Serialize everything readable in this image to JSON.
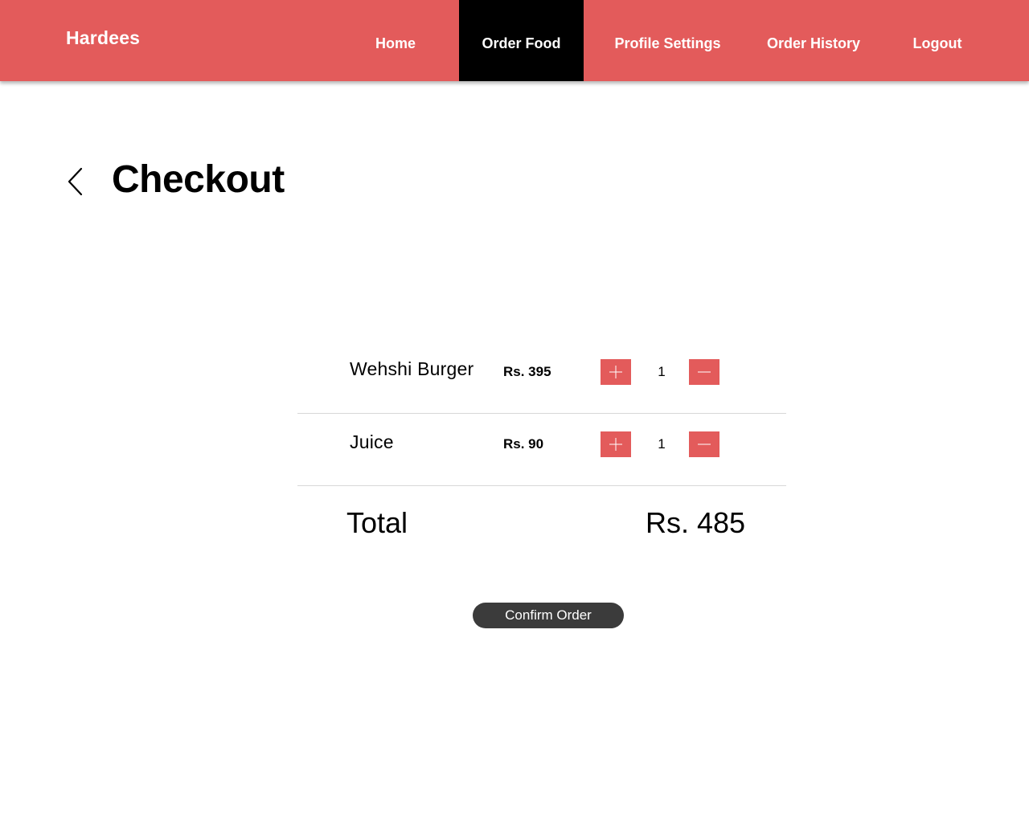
{
  "brand": "Hardees",
  "nav": {
    "home": "Home",
    "order_food": "Order Food",
    "profile_settings": "Profile Settings",
    "order_history": "Order History",
    "logout": "Logout",
    "active": "Order Food"
  },
  "page": {
    "title": "Checkout",
    "back_icon": "chevron-left-icon"
  },
  "cart": {
    "items": [
      {
        "name": "Wehshi Burger",
        "price": "Rs. 395",
        "quantity": "1"
      },
      {
        "name": "Juice",
        "price": "Rs. 90",
        "quantity": "1"
      }
    ],
    "total_label": "Total",
    "total_value": "Rs. 485"
  },
  "actions": {
    "confirm_label": "Confirm Order"
  },
  "colors": {
    "accent": "#e35b5b",
    "active_nav": "#000000",
    "button_dark": "#3b3b3b"
  }
}
